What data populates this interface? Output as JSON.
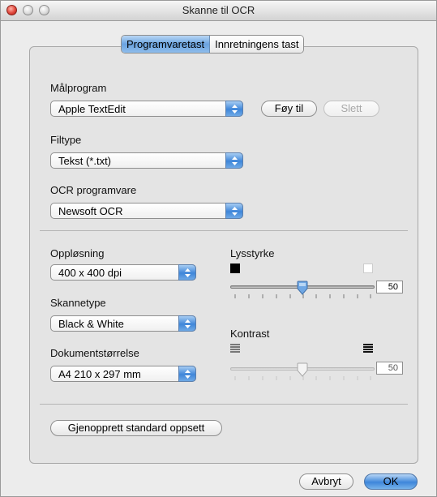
{
  "window": {
    "title": "Skanne til OCR"
  },
  "tabs": [
    {
      "label": "Programvaretast",
      "active": true
    },
    {
      "label": "Innretningens tast",
      "active": false
    }
  ],
  "target_app": {
    "label": "Målprogram",
    "value": "Apple TextEdit",
    "add_button": "Føy til",
    "delete_button": "Slett"
  },
  "file_type": {
    "label": "Filtype",
    "value": "Tekst (*.txt)"
  },
  "ocr_software": {
    "label": "OCR programvare",
    "value": "Newsoft OCR"
  },
  "resolution": {
    "label": "Oppløsning",
    "value": "400 x 400 dpi"
  },
  "scan_type": {
    "label": "Skannetype",
    "value": "Black & White"
  },
  "document_size": {
    "label": "Dokumentstørrelse",
    "value": "A4 210 x 297 mm"
  },
  "brightness": {
    "label": "Lysstyrke",
    "value": "50",
    "level": 50,
    "enabled": true
  },
  "contrast": {
    "label": "Kontrast",
    "value": "50",
    "level": 50,
    "enabled": false
  },
  "restore_button": "Gjenopprett standard oppsett",
  "footer": {
    "cancel": "Avbryt",
    "ok": "OK"
  },
  "colors": {
    "accent": "#3e86da",
    "window_bg": "#ececec"
  }
}
